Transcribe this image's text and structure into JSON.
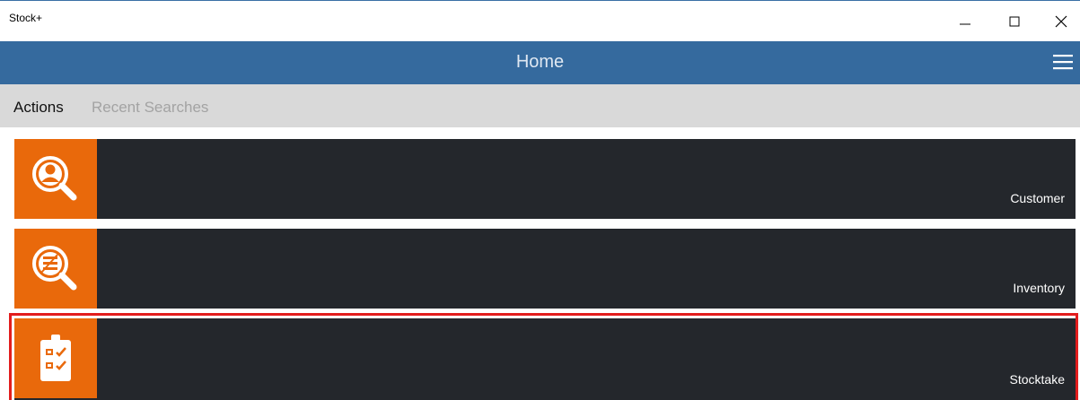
{
  "window": {
    "title": "Stock+",
    "minimize_icon": "minimize-icon",
    "maximize_icon": "maximize-icon",
    "close_icon": "close-icon"
  },
  "header": {
    "title": "Home",
    "menu_icon": "hamburger-menu-icon",
    "background": "#356a9e"
  },
  "tabs": [
    {
      "label": "Actions",
      "selected": true
    },
    {
      "label": "Recent Searches",
      "selected": false
    }
  ],
  "tiles": [
    {
      "label": "Customer",
      "icon": "customer-search-icon",
      "accent": "#e9690b"
    },
    {
      "label": "Inventory",
      "icon": "inventory-search-icon",
      "accent": "#e9690b"
    },
    {
      "label": "Stocktake",
      "icon": "clipboard-checklist-icon",
      "accent": "#e9690b",
      "highlighted": true
    }
  ],
  "colors": {
    "tile_background": "#24272c",
    "tab_bar": "#d9d9d9",
    "highlight_border": "#e21d1d"
  }
}
